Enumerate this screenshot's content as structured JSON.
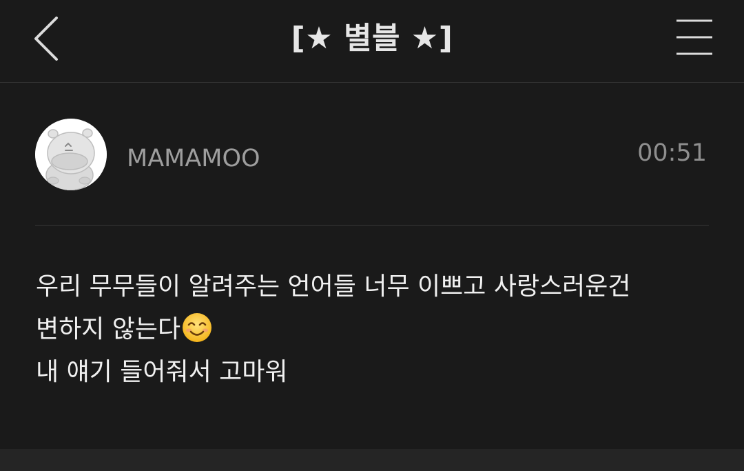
{
  "header": {
    "back_icon": "chevron-left-icon",
    "title": "[★ 별블 ★]",
    "menu_icon": "hamburger-menu-icon"
  },
  "post": {
    "author": "MAMAMOO",
    "time": "00:51",
    "avatar_icon": "hippo-avatar-icon",
    "message_lines": [
      "우리 무무들이 알려주는 언어들 너무 이쁘고 사랑스러운건",
      "변하지 않는다",
      "내 얘기 들어줘서 고마워"
    ],
    "emoji": "smiling-face-emoji"
  },
  "colors": {
    "background": "#1a1a1a",
    "title": "#e6e6e6",
    "author": "#9e9e9e",
    "time": "#8f8f8f",
    "message": "#f0f0f0",
    "bottom_bar": "#252525"
  }
}
